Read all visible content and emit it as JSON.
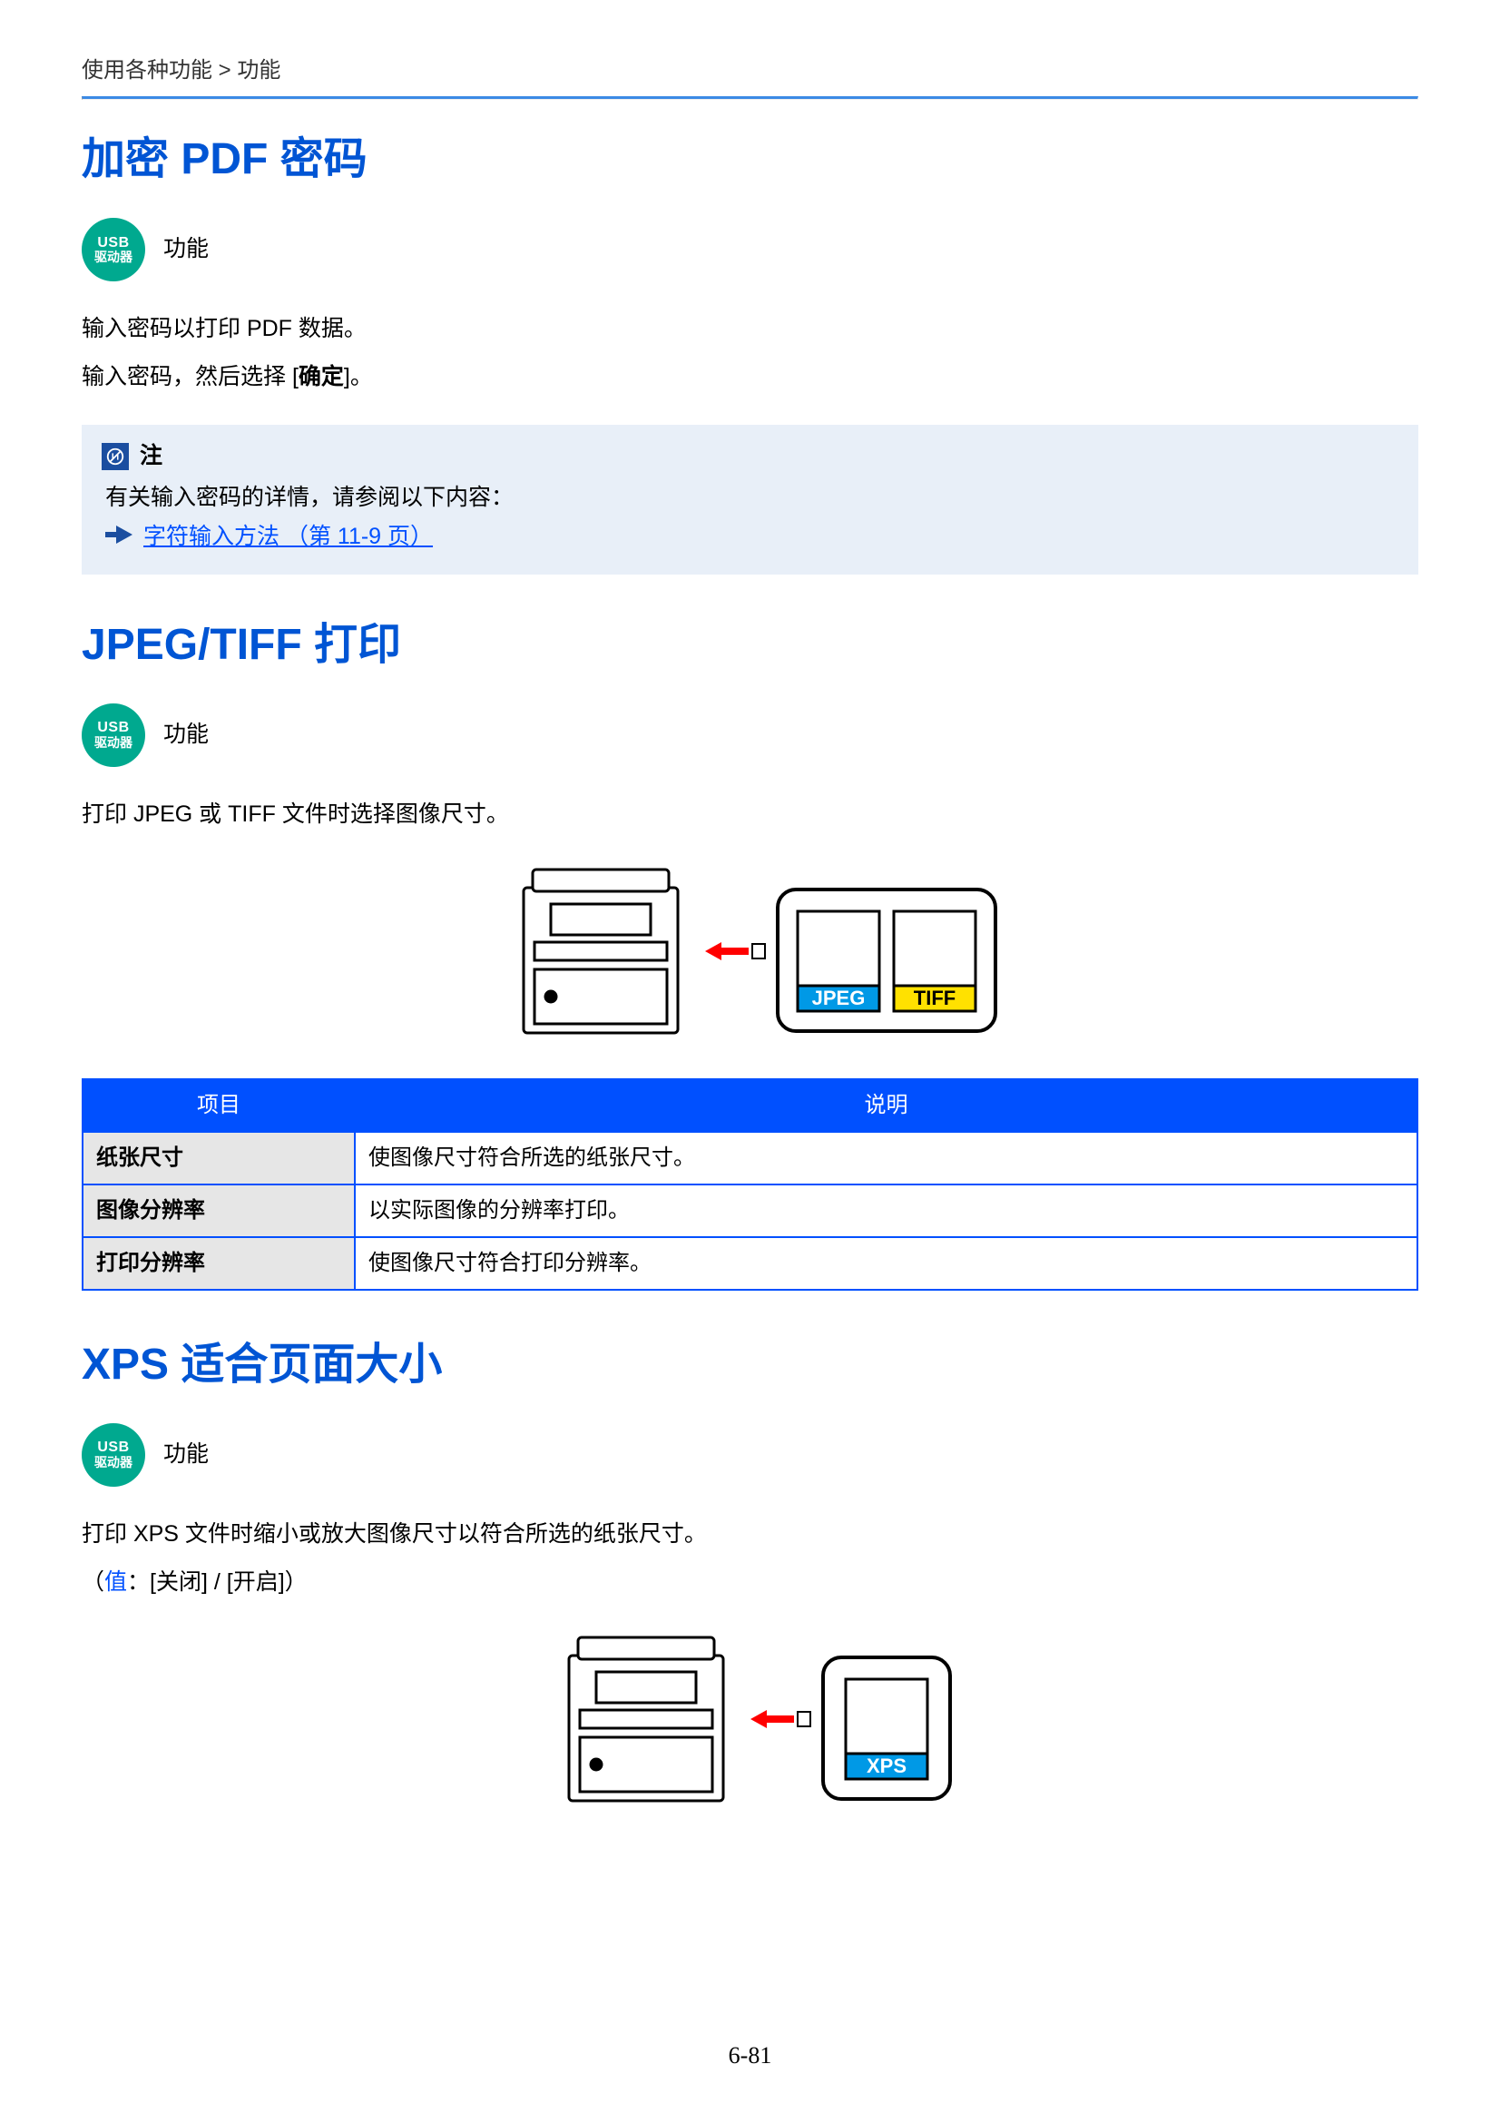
{
  "breadcrumb": "使用各种功能 > 功能",
  "usb_badge": {
    "line1": "USB",
    "line2": "驱动器"
  },
  "func_label": "功能",
  "section1": {
    "title_accent": "加密 PDF 密码",
    "p1": "输入密码以打印 PDF 数据。",
    "p2_pre": "输入密码，然后选择 [",
    "p2_bold": "确定",
    "p2_post": "]。"
  },
  "note": {
    "label": "注",
    "body": "有关输入密码的详情，请参阅以下内容：",
    "link": "字符输入方法 （第 11-9 页）"
  },
  "section2": {
    "title_accent": "JPEG/TIFF",
    "title_rest": " 打印",
    "p1": "打印 JPEG 或 TIFF 文件时选择图像尺寸。",
    "illus_labels": {
      "jpeg": "JPEG",
      "tiff": "TIFF"
    },
    "table": {
      "h0": "项目",
      "h1": "说明",
      "rows": [
        {
          "c0": "纸张尺寸",
          "c1": "使图像尺寸符合所选的纸张尺寸。"
        },
        {
          "c0": "图像分辨率",
          "c1": "以实际图像的分辨率打印。"
        },
        {
          "c0": "打印分辨率",
          "c1": "使图像尺寸符合打印分辨率。"
        }
      ]
    }
  },
  "section3": {
    "title_accent": "XPS",
    "title_rest": " 适合页面大小",
    "p1": "打印 XPS 文件时缩小或放大图像尺寸以符合所选的纸张尺寸。",
    "value_label": "值",
    "value_rest": "：[关闭] / [开启]",
    "illus_label": "XPS"
  },
  "page_number": "6-81"
}
